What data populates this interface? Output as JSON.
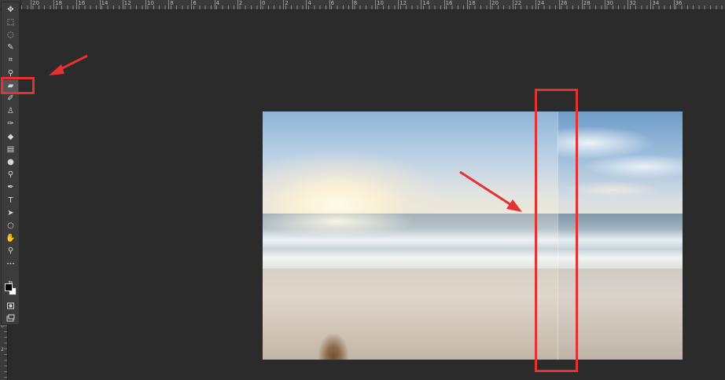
{
  "rulers": {
    "top_labels": [
      "20",
      "18",
      "16",
      "14",
      "12",
      "10",
      "8",
      "6",
      "4",
      "2",
      "0",
      "2",
      "4",
      "6",
      "8",
      "10",
      "12",
      "14",
      "16",
      "18",
      "20",
      "22",
      "24",
      "26",
      "28",
      "30",
      "32",
      "34",
      "36"
    ],
    "left_labels": [
      "0",
      "2"
    ]
  },
  "toolbar": {
    "tools": [
      {
        "name": "move-tool",
        "glyph": "✥"
      },
      {
        "name": "marquee-tool",
        "glyph": "⬚"
      },
      {
        "name": "lasso-tool",
        "glyph": "◌"
      },
      {
        "name": "quick-select-tool",
        "glyph": "✎"
      },
      {
        "name": "crop-tool",
        "glyph": "⌗"
      },
      {
        "name": "eyedropper-tool",
        "glyph": "⚲"
      },
      {
        "name": "patch-tool",
        "glyph": "▰",
        "active": true
      },
      {
        "name": "brush-tool",
        "glyph": "✐"
      },
      {
        "name": "stamp-tool",
        "glyph": "♙"
      },
      {
        "name": "history-brush-tool",
        "glyph": "✑"
      },
      {
        "name": "eraser-tool",
        "glyph": "◆"
      },
      {
        "name": "gradient-tool",
        "glyph": "▤"
      },
      {
        "name": "blur-tool",
        "glyph": "●"
      },
      {
        "name": "dodge-tool",
        "glyph": "⚲"
      },
      {
        "name": "pen-tool",
        "glyph": "✒"
      },
      {
        "name": "type-tool",
        "glyph": "T"
      },
      {
        "name": "path-select-tool",
        "glyph": "➤"
      },
      {
        "name": "ellipse-tool",
        "glyph": "○"
      },
      {
        "name": "hand-tool",
        "glyph": "✋"
      },
      {
        "name": "zoom-tool",
        "glyph": "⚲"
      },
      {
        "name": "more-tools",
        "glyph": "•••"
      }
    ],
    "colors": {
      "foreground": "#000000",
      "background": "#ffffff"
    }
  },
  "annotations": {
    "color": "#e5312f"
  }
}
